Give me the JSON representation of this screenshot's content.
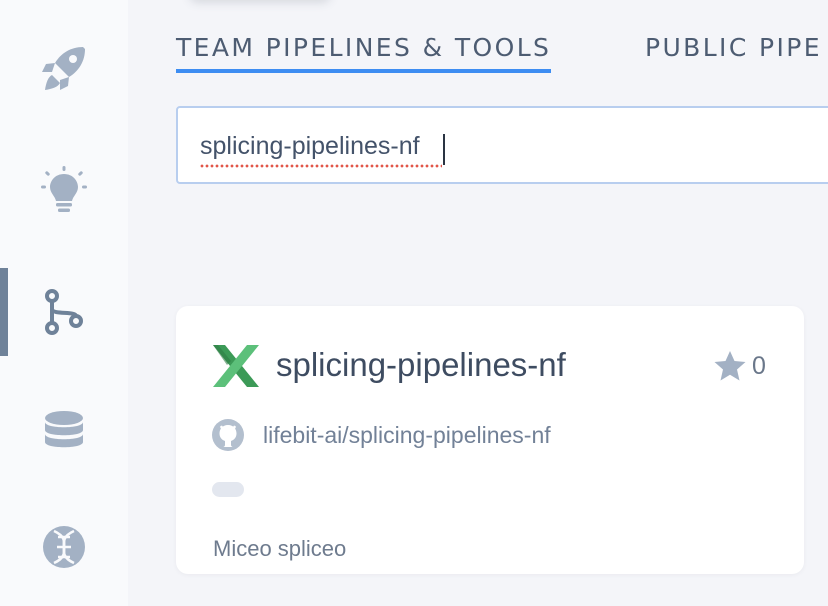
{
  "tabs": [
    {
      "label": "TEAM PIPELINES & TOOLS",
      "active": true
    },
    {
      "label": "PUBLIC PIPE"
    }
  ],
  "search": {
    "value": "splicing-pipelines-nf"
  },
  "sidebar": {
    "items": [
      {
        "icon": "rocket-icon"
      },
      {
        "icon": "lightbulb-icon"
      },
      {
        "icon": "pipeline-fork-icon",
        "active": true
      },
      {
        "icon": "database-icon"
      },
      {
        "icon": "dna-icon"
      }
    ]
  },
  "pipeline_card": {
    "title": "splicing-pipelines-nf",
    "stars": "0",
    "repo": "lifebit-ai/splicing-pipelines-nf",
    "description": "Miceo spliceo",
    "logo": "nextflow-logo",
    "logo_color": "#4dae6a"
  },
  "colors": {
    "accent": "#3d8df2",
    "sidebar_icon": "#a3b1c4",
    "active_icon": "#6f8299",
    "text": "#4d5c72"
  }
}
